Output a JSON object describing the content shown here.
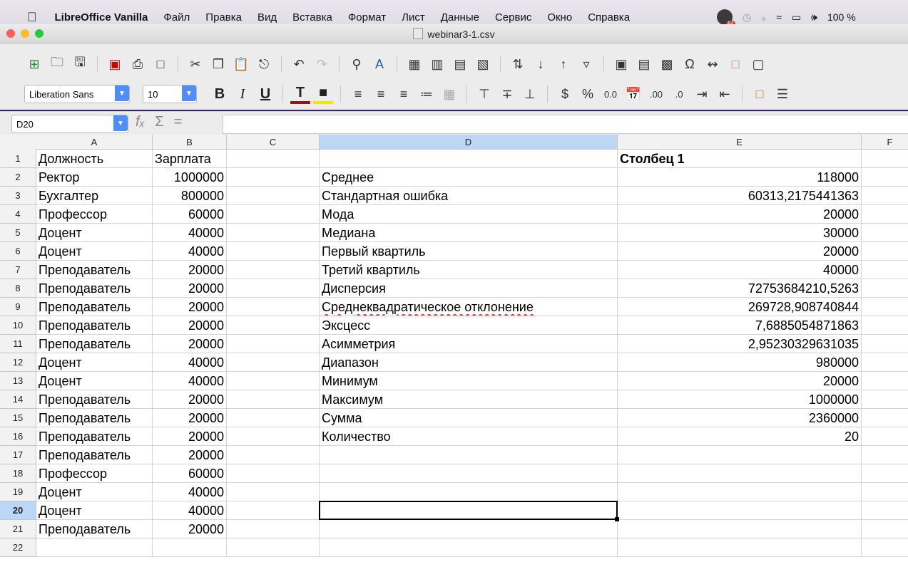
{
  "menubar": {
    "app_name": "LibreOffice Vanilla",
    "items": [
      "Файл",
      "Правка",
      "Вид",
      "Вставка",
      "Формат",
      "Лист",
      "Данные",
      "Сервис",
      "Окно",
      "Справка"
    ],
    "badge": "64",
    "battery": "100 %"
  },
  "window": {
    "title": "webinar3-1.csv"
  },
  "toolbar": {
    "font_name": "Liberation Sans",
    "font_size": "10"
  },
  "formula": {
    "cell_ref": "D20",
    "content": ""
  },
  "grid": {
    "columns": [
      "A",
      "B",
      "C",
      "D",
      "E",
      "F"
    ],
    "selected_column": "D",
    "selected_row": 20,
    "rows": [
      {
        "n": "1",
        "A": "Должность",
        "B": "Зарплата",
        "D": "",
        "E": "Столбец 1"
      },
      {
        "n": "2",
        "A": "Ректор",
        "B": "1000000",
        "D": "Среднее",
        "E": "118000"
      },
      {
        "n": "3",
        "A": "Бухгалтер",
        "B": "800000",
        "D": "Стандартная ошибка",
        "E": "60313,2175441363"
      },
      {
        "n": "4",
        "A": "Профессор",
        "B": "60000",
        "D": "Мода",
        "E": "20000"
      },
      {
        "n": "5",
        "A": "Доцент",
        "B": "40000",
        "D": "Медиана",
        "E": "30000"
      },
      {
        "n": "6",
        "A": "Доцент",
        "B": "40000",
        "D": "Первый квартиль",
        "E": "20000"
      },
      {
        "n": "7",
        "A": "Преподаватель",
        "B": "20000",
        "D": "Третий квартиль",
        "E": "40000"
      },
      {
        "n": "8",
        "A": "Преподаватель",
        "B": "20000",
        "D": "Дисперсия",
        "E": "72753684210,5263"
      },
      {
        "n": "9",
        "A": "Преподаватель",
        "B": "20000",
        "D": "Среднеквадратическое отклонение",
        "E": "269728,908740844"
      },
      {
        "n": "10",
        "A": "Преподаватель",
        "B": "20000",
        "D": "Эксцесс",
        "E": "7,6885054871863"
      },
      {
        "n": "11",
        "A": "Преподаватель",
        "B": "20000",
        "D": "Асимметрия",
        "E": "2,95230329631035"
      },
      {
        "n": "12",
        "A": "Доцент",
        "B": "40000",
        "D": "Диапазон",
        "E": "980000"
      },
      {
        "n": "13",
        "A": "Доцент",
        "B": "40000",
        "D": "Минимум",
        "E": "20000"
      },
      {
        "n": "14",
        "A": "Преподаватель",
        "B": "20000",
        "D": "Максимум",
        "E": "1000000"
      },
      {
        "n": "15",
        "A": "Преподаватель",
        "B": "20000",
        "D": "Сумма",
        "E": "2360000"
      },
      {
        "n": "16",
        "A": "Преподаватель",
        "B": "20000",
        "D": "Количество",
        "E": "20"
      },
      {
        "n": "17",
        "A": "Преподаватель",
        "B": "20000",
        "D": "",
        "E": ""
      },
      {
        "n": "18",
        "A": "Профессор",
        "B": "60000",
        "D": "",
        "E": ""
      },
      {
        "n": "19",
        "A": "Доцент",
        "B": "40000",
        "D": "",
        "E": ""
      },
      {
        "n": "20",
        "A": "Доцент",
        "B": "40000",
        "D": "",
        "E": ""
      },
      {
        "n": "21",
        "A": "Преподаватель",
        "B": "20000",
        "D": "",
        "E": ""
      },
      {
        "n": "22",
        "A": "",
        "B": "",
        "D": "",
        "E": ""
      }
    ]
  }
}
